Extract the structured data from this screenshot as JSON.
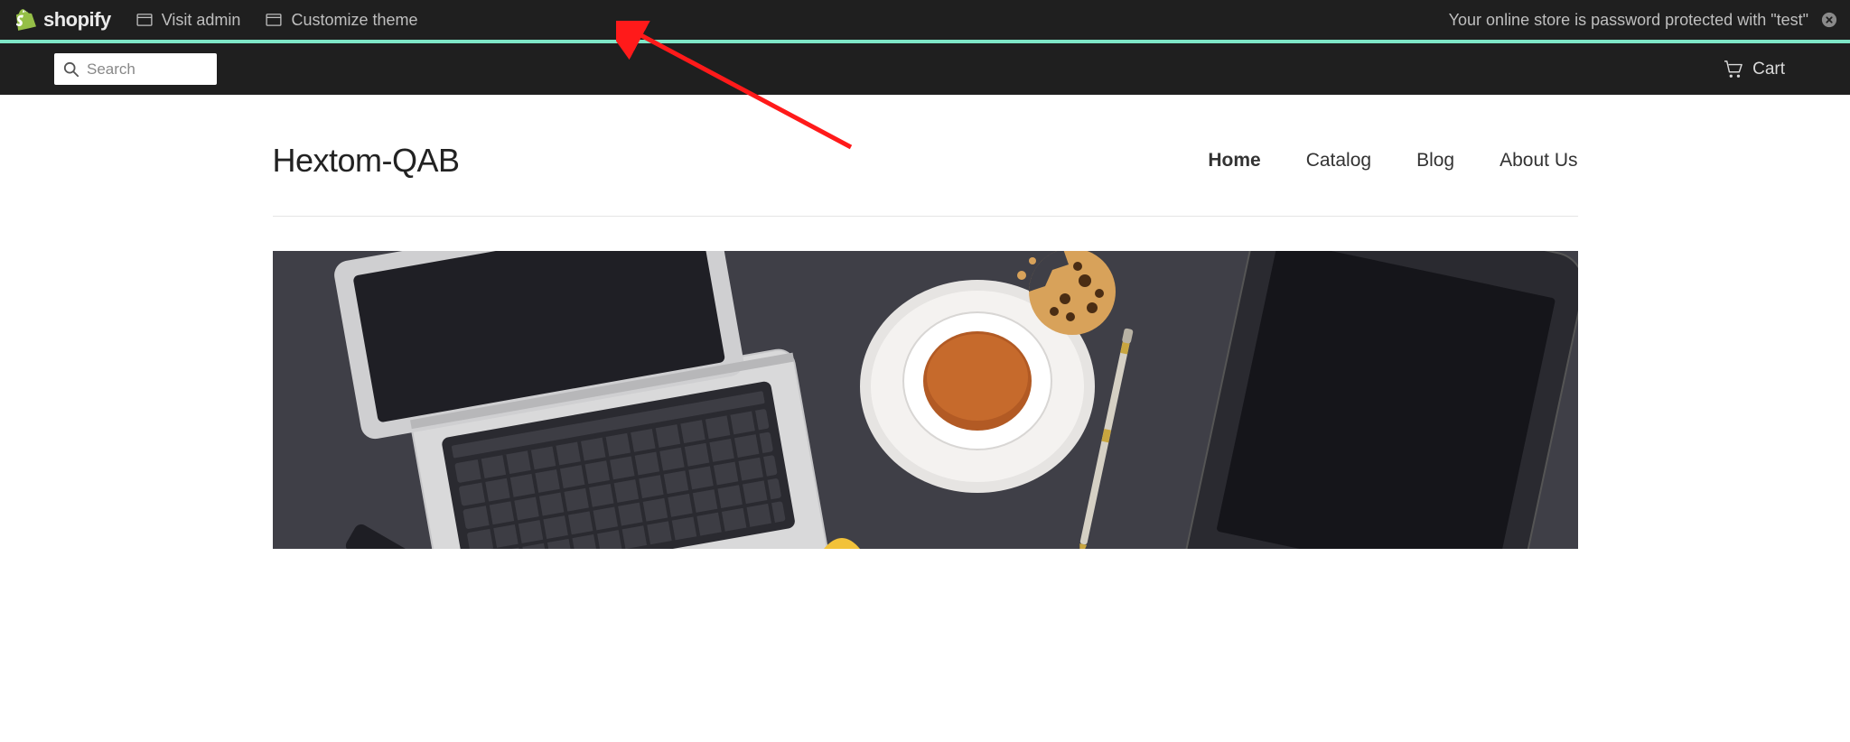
{
  "admin_bar": {
    "brand": "shopify",
    "visit_admin": "Visit admin",
    "customize_theme": "Customize theme",
    "notice": "Your online store is password protected with \"test\""
  },
  "util_bar": {
    "search_placeholder": "Search",
    "cart_label": "Cart"
  },
  "header": {
    "store_name": "Hextom-QAB",
    "nav": [
      {
        "label": "Home",
        "active": true
      },
      {
        "label": "Catalog",
        "active": false
      },
      {
        "label": "Blog",
        "active": false
      },
      {
        "label": "About Us",
        "active": false
      }
    ]
  }
}
